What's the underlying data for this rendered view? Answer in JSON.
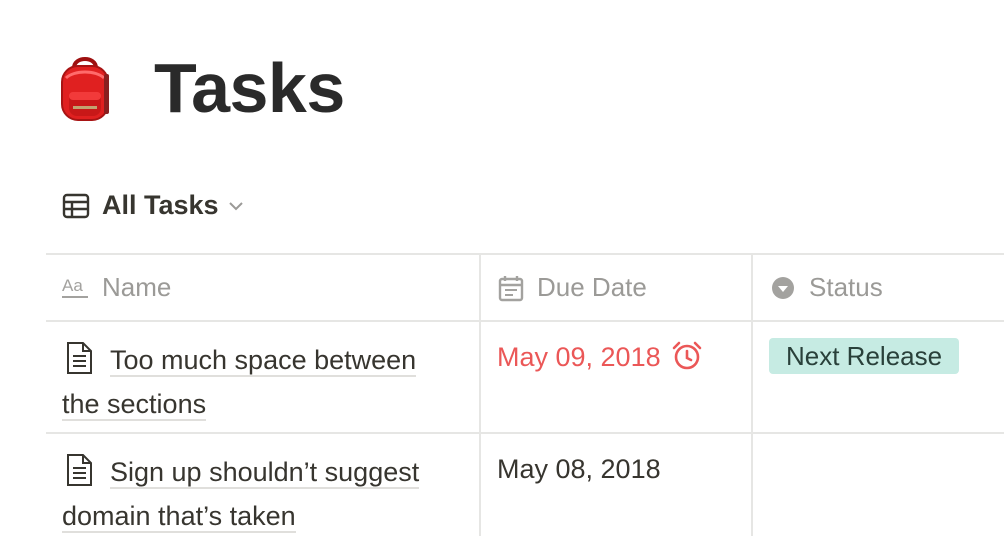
{
  "page": {
    "title": "Tasks",
    "emoji_icon": "backpack-icon"
  },
  "view": {
    "label": "All Tasks",
    "icon": "table-icon",
    "dropdown_icon": "chevron-down-icon"
  },
  "table": {
    "columns": [
      {
        "label": "Name",
        "icon": "text-property-icon"
      },
      {
        "label": "Due Date",
        "icon": "calendar-icon"
      },
      {
        "label": "Status",
        "icon": "select-property-icon"
      }
    ],
    "rows": [
      {
        "name": "Too much space between the sections",
        "due_date": "May 09, 2018",
        "due_overdue": true,
        "status": "Next Release"
      },
      {
        "name": "Sign up shouldn’t suggest domain that’s taken",
        "due_date": "May 08, 2018",
        "due_overdue": false,
        "status": ""
      }
    ]
  },
  "colors": {
    "overdue": "#eb5757",
    "status_tag_bg": "#c6ebe3",
    "header_text": "#9b9a97",
    "body_text": "#37352f"
  }
}
